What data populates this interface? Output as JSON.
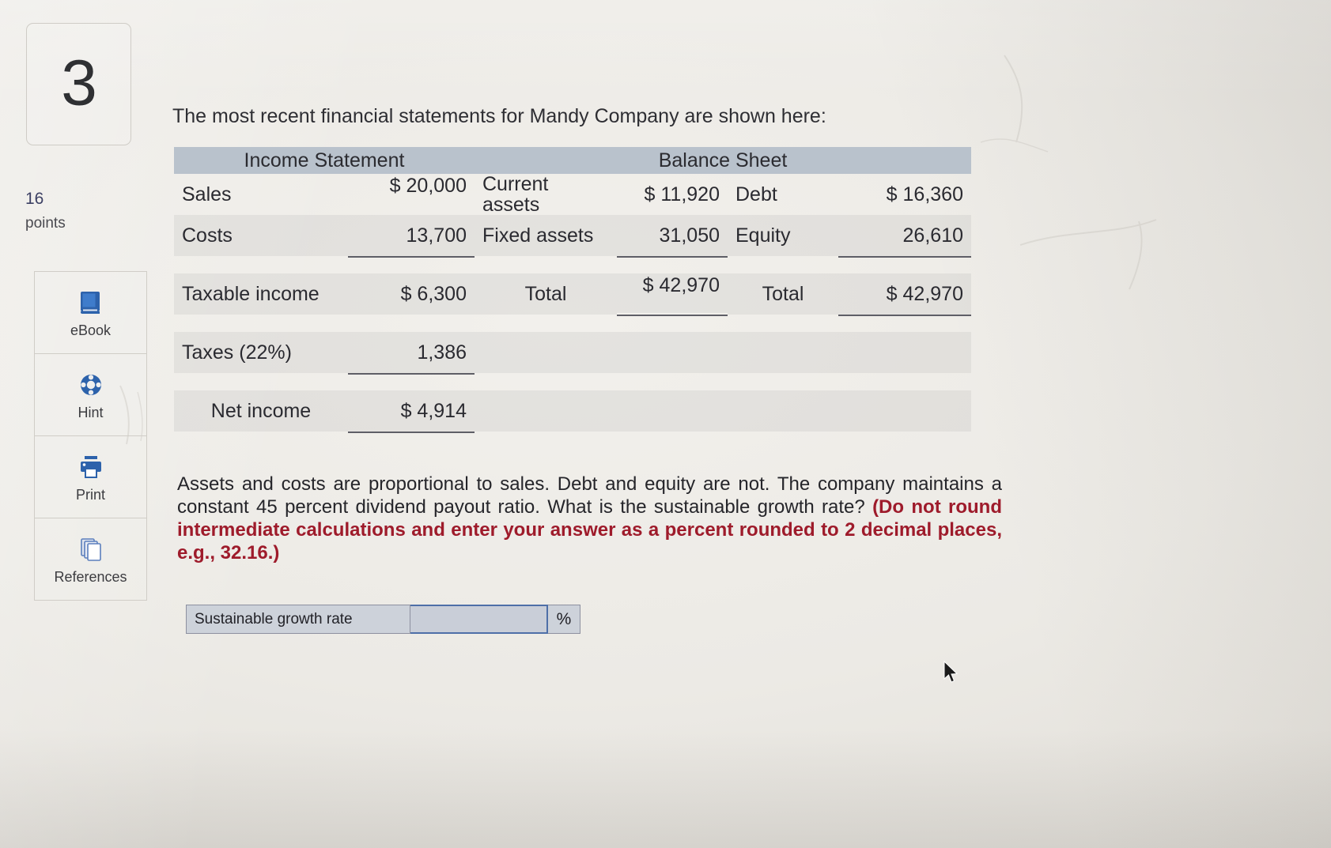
{
  "question": {
    "number": "3",
    "points_value": "16",
    "points_label": "points",
    "intro": "The most recent financial statements for Mandy Company are shown here:",
    "body_plain_1": "Assets and costs are proportional to sales. Debt and equity are not. The company maintains a constant 45 percent dividend payout ratio. What is the sustainable growth rate? ",
    "body_bold_red": "(Do not round intermediate calculations and enter your answer as a percent rounded to 2 decimal places, e.g., 32.16.)"
  },
  "toolbar": {
    "items": [
      {
        "label": "eBook",
        "icon": "book-icon"
      },
      {
        "label": "Hint",
        "icon": "lifebuoy-icon"
      },
      {
        "label": "Print",
        "icon": "printer-icon"
      },
      {
        "label": "References",
        "icon": "copy-pages-icon"
      }
    ]
  },
  "tables": {
    "income_statement": {
      "header": "Income Statement",
      "rows": [
        {
          "label": "Sales",
          "value": "$ 20,000"
        },
        {
          "label": "Costs",
          "value": "13,700"
        },
        {
          "label": "Taxable income",
          "value": "$ 6,300"
        },
        {
          "label": "Taxes (22%)",
          "value": "1,386"
        },
        {
          "label": "Net income",
          "value": "$ 4,914"
        }
      ]
    },
    "balance_sheet": {
      "header": "Balance Sheet",
      "assets": [
        {
          "label": "Current assets",
          "value": "$ 11,920"
        },
        {
          "label": "Fixed assets",
          "value": "31,050"
        },
        {
          "label": "Total",
          "value": "$ 42,970"
        }
      ],
      "liabilities": [
        {
          "label": "Debt",
          "value": "$ 16,360"
        },
        {
          "label": "Equity",
          "value": "26,610"
        },
        {
          "label": "Total",
          "value": "$ 42,970"
        }
      ]
    }
  },
  "answer": {
    "label": "Sustainable growth rate",
    "value": "",
    "placeholder": "",
    "unit": "%"
  },
  "colors": {
    "table_header_bg": "#b9c2cc",
    "red_bold": "#9e1b2b",
    "points_blue": "#3b3f63",
    "input_border": "#4e6fa8"
  }
}
